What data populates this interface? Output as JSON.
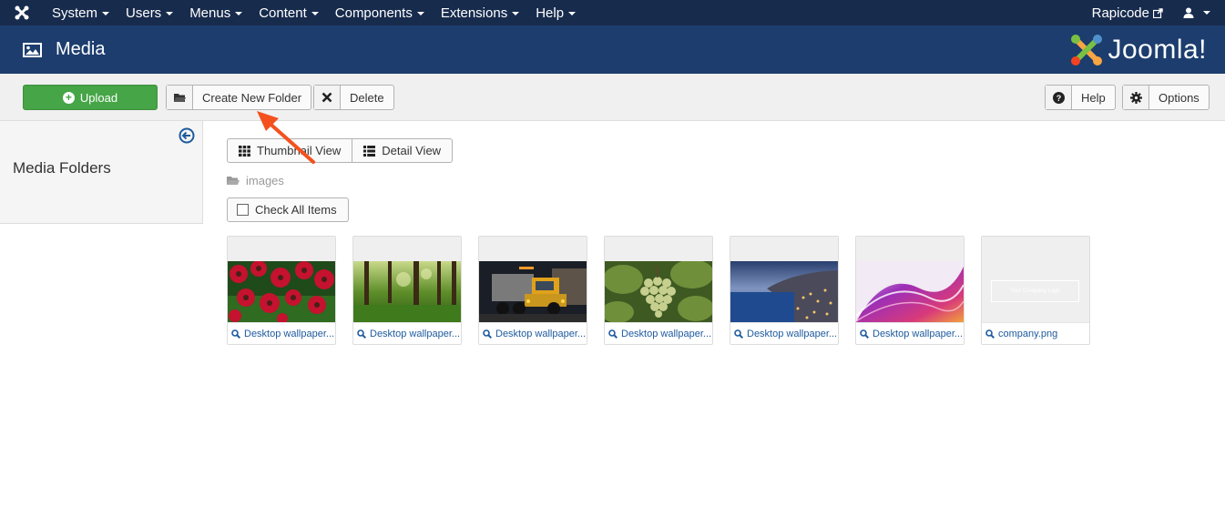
{
  "navbar": {
    "menu": [
      {
        "label": "System"
      },
      {
        "label": "Users"
      },
      {
        "label": "Menus"
      },
      {
        "label": "Content"
      },
      {
        "label": "Components"
      },
      {
        "label": "Extensions"
      },
      {
        "label": "Help"
      }
    ],
    "site_name": "Rapicode"
  },
  "header": {
    "title": "Media",
    "brand": "Joomla!"
  },
  "toolbar": {
    "upload_label": "Upload",
    "create_folder_label": "Create New Folder",
    "delete_label": "Delete",
    "help_label": "Help",
    "options_label": "Options"
  },
  "sidebar": {
    "title": "Media Folders"
  },
  "main": {
    "thumbnail_view_label": "Thumbnail View",
    "detail_view_label": "Detail View",
    "breadcrumb": "images",
    "check_all_label": "Check All Items",
    "logo_placeholder": "Your Company Logo",
    "items": [
      {
        "name": "Desktop wallpaper..."
      },
      {
        "name": "Desktop wallpaper..."
      },
      {
        "name": "Desktop wallpaper..."
      },
      {
        "name": "Desktop wallpaper..."
      },
      {
        "name": "Desktop wallpaper..."
      },
      {
        "name": "Desktop wallpaper..."
      },
      {
        "name": "company.png"
      }
    ]
  },
  "colors": {
    "navbar": "#172b4d",
    "header": "#1c3d6e",
    "upload": "#46a546",
    "annotation_arrow": "#f4511e"
  }
}
